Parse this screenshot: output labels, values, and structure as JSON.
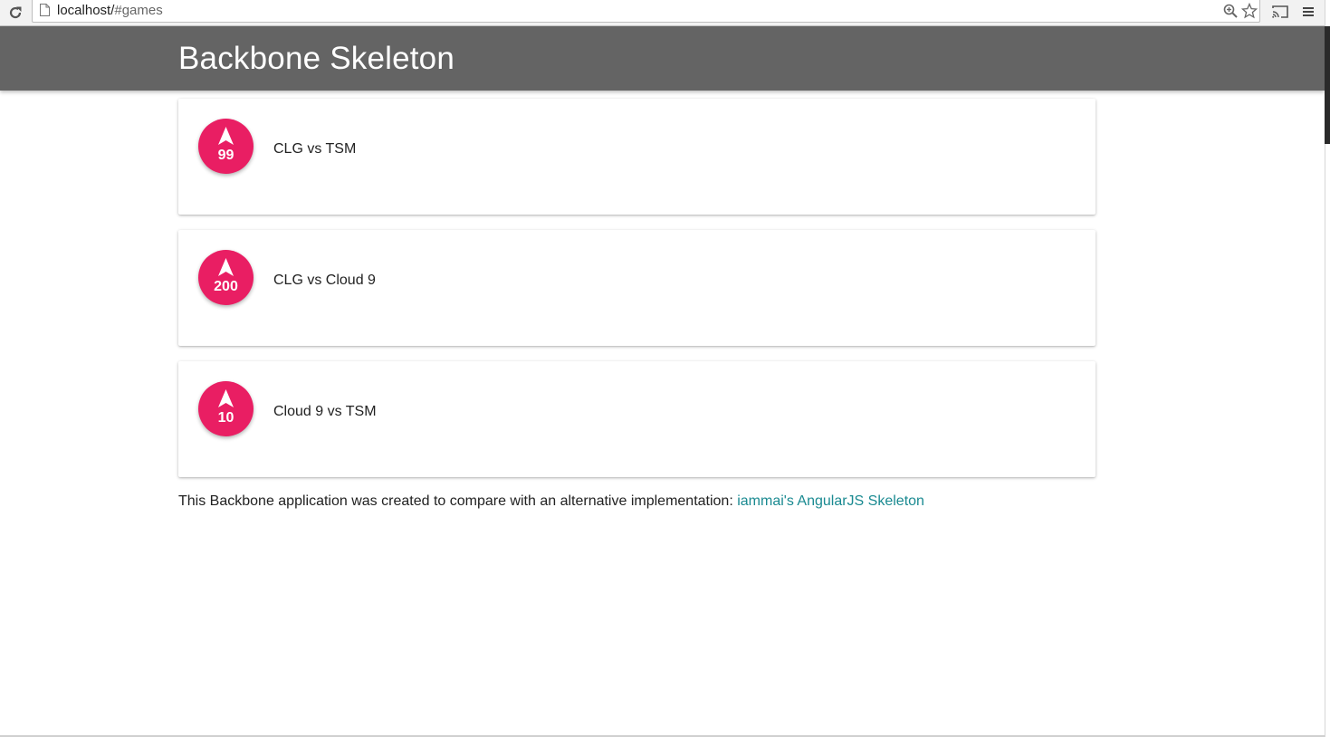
{
  "browser": {
    "url_host": "localhost/",
    "url_path": "#games"
  },
  "header": {
    "title": "Backbone Skeleton"
  },
  "games": [
    {
      "votes": "99",
      "title": "CLG vs TSM"
    },
    {
      "votes": "200",
      "title": "CLG vs Cloud 9"
    },
    {
      "votes": "10",
      "title": "Cloud 9 vs TSM"
    }
  ],
  "footer": {
    "text": "This Backbone application was created to compare with an alternative implementation: ",
    "link_label": "iammai's AngularJS Skeleton"
  },
  "colors": {
    "header_bg": "#646464",
    "vote_button": "#e91e63",
    "link": "#1a8a91"
  },
  "icons": {
    "reload": "reload-icon",
    "page": "page-icon",
    "zoom": "zoom-icon",
    "bookmark": "star-icon",
    "cast": "cast-icon",
    "menu": "hamburger-menu-icon",
    "vote": "navigation-arrow-icon"
  }
}
